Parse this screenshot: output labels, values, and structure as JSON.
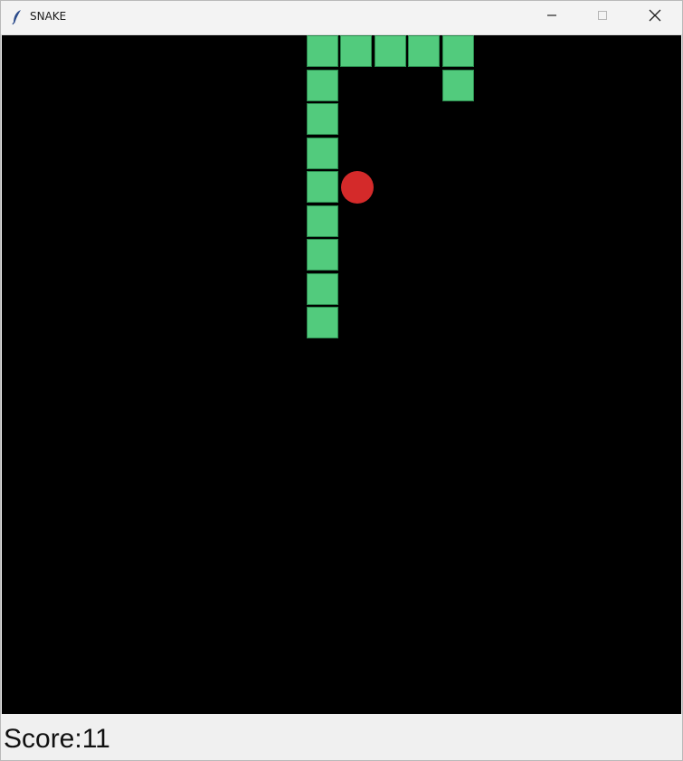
{
  "window": {
    "title": "SNAKE",
    "icons": {
      "app": "feather-icon",
      "minimize": "minimize-icon",
      "maximize": "maximize-icon",
      "close": "close-icon"
    }
  },
  "game": {
    "background_color": "#000000",
    "snake_color": "#52cb7d",
    "food_color": "#d42a2a",
    "grid_cell": 37.5,
    "snake_cells": [
      [
        9,
        0
      ],
      [
        10,
        0
      ],
      [
        11,
        0
      ],
      [
        12,
        0
      ],
      [
        13,
        0
      ],
      [
        13,
        1
      ],
      [
        9,
        1
      ],
      [
        9,
        2
      ],
      [
        9,
        3
      ],
      [
        9,
        4
      ],
      [
        9,
        5
      ],
      [
        9,
        6
      ],
      [
        9,
        7
      ],
      [
        9,
        8
      ]
    ],
    "food_cell": [
      10,
      4
    ]
  },
  "status": {
    "score_text": "Score:11"
  }
}
